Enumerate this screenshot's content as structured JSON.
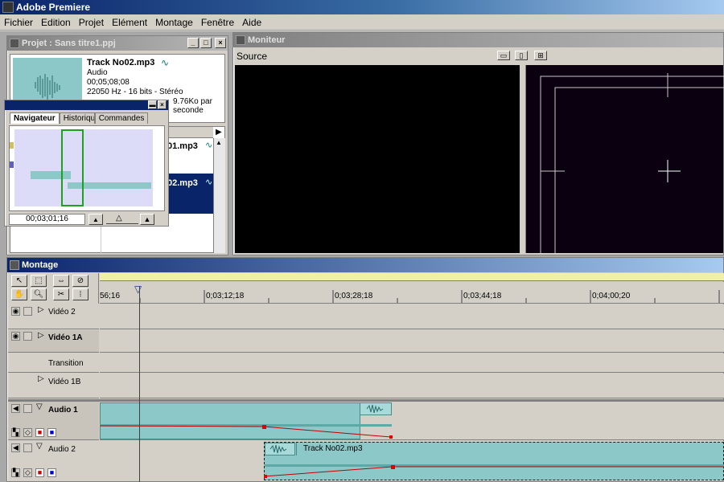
{
  "app": {
    "title": "Adobe Premiere"
  },
  "menu": [
    "Fichier",
    "Edition",
    "Projet",
    "Elément",
    "Montage",
    "Fenêtre",
    "Aide"
  ],
  "project": {
    "title": "Projet : Sans titre1.ppj",
    "clip_name": "Track No02.mp3",
    "clip_type": "Audio",
    "duration": "00;05;08;08",
    "format": "22050 Hz - 16 bits - Stéréo",
    "rate_partial": "9.76Ko par seconde",
    "list_item1": "01.mp3",
    "list_item2": "02.mp3"
  },
  "navigator": {
    "tabs": [
      "Navigateur",
      "Historique",
      "Commandes"
    ],
    "timecode": "00;03;01;16"
  },
  "monitor": {
    "title": "Moniteur",
    "source_label": "Source"
  },
  "timeline": {
    "title": "Montage",
    "ticks": [
      "56;16",
      "0;03;12;18",
      "0;03;28;18",
      "0;03;44;18",
      "0;04;00;20"
    ],
    "tracks": {
      "video2": "Vidéo 2",
      "video1a": "Vidéo 1A",
      "transition": "Transition",
      "video1b": "Vidéo 1B",
      "audio1": "Audio 1",
      "audio2": "Audio 2"
    },
    "audio2_clip_name": "Track No02.mp3"
  },
  "colors": {
    "title_active": "#0a246a",
    "clip": "#8cc8c8",
    "navigator_bg": "#dcdcf8",
    "selected_row": "#0a246a",
    "volume_line": "#c00000"
  }
}
